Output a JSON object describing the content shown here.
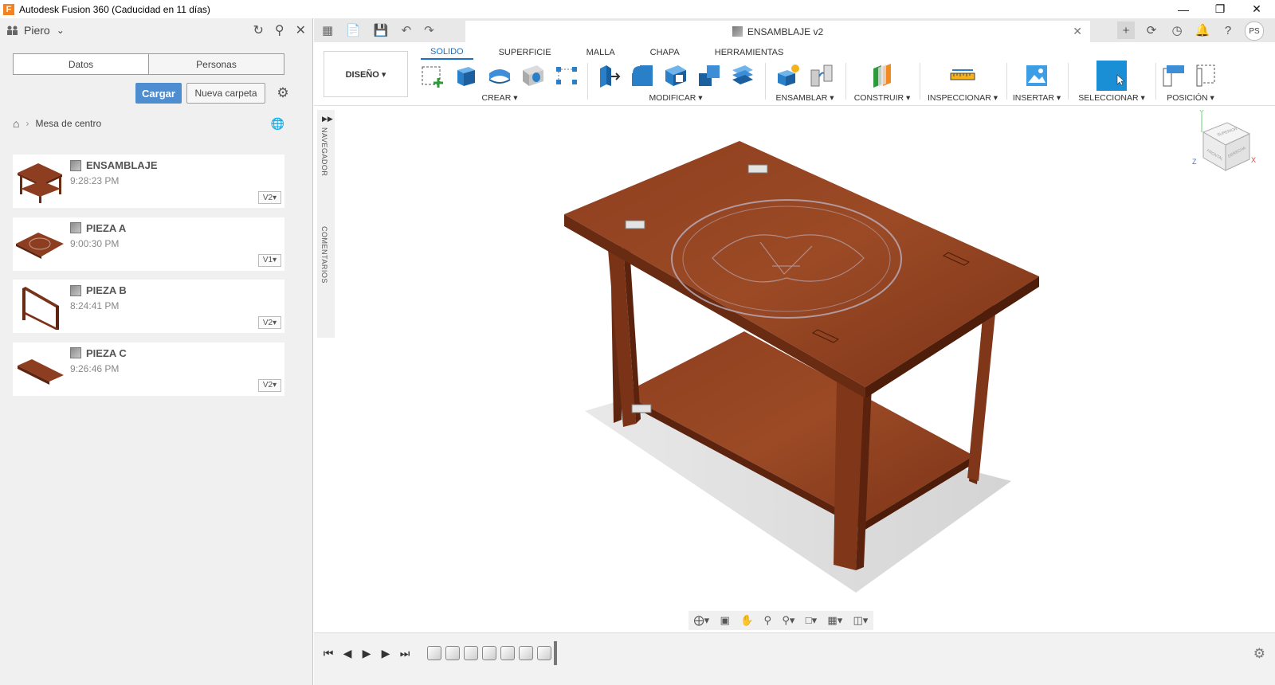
{
  "window": {
    "title": "Autodesk Fusion 360 (Caducidad en 11 días)",
    "app_icon": "F",
    "controls": [
      "minimize-icon",
      "restore-icon",
      "close-icon"
    ]
  },
  "data_panel": {
    "user": "Piero",
    "tabs": [
      {
        "label": "Datos",
        "active": true
      },
      {
        "label": "Personas",
        "active": false
      }
    ],
    "upload_label": "Cargar",
    "new_folder_label": "Nueva carpeta",
    "breadcrumb": "Mesa de centro",
    "files": [
      {
        "name": "ENSAMBLAJE",
        "time": "9:28:23 PM",
        "version": "V2▾"
      },
      {
        "name": "PIEZA A",
        "time": "9:00:30 PM",
        "version": "V1▾"
      },
      {
        "name": "PIEZA B",
        "time": "8:24:41 PM",
        "version": "V2▾"
      },
      {
        "name": "PIEZA C",
        "time": "9:26:46 PM",
        "version": "V2▾"
      }
    ]
  },
  "document": {
    "tab_title": "ENSAMBLAJE v2",
    "user_initials": "PS"
  },
  "ribbon": {
    "workspace": "DISEÑO ▾",
    "tabs": [
      "SOLIDO",
      "SUPERFICIE",
      "MALLA",
      "CHAPA",
      "HERRAMIENTAS"
    ],
    "active_tab": "SOLIDO",
    "groups": {
      "create": "CREAR ▾",
      "modify": "MODIFICAR ▾",
      "assemble": "ENSAMBLAR ▾",
      "construct": "CONSTRUIR ▾",
      "inspect": "INSPECCIONAR ▾",
      "insert": "INSERTAR ▾",
      "select": "SELECCIONAR ▾",
      "position": "POSICIÓN ▾"
    }
  },
  "canvas": {
    "side_labels": [
      "NAVEGADOR",
      "COMENTARIOS"
    ],
    "viewcube": {
      "top": "SUPERIOR",
      "front": "FRONTAL",
      "right": "DERECHA",
      "axes": [
        "Y",
        "Z",
        "X"
      ]
    },
    "colors": {
      "wood": "#8a3b1e",
      "wood_dark": "#6d2a13",
      "shadow": "#d8d8d8",
      "select_blue": "#1b8fd6"
    }
  }
}
